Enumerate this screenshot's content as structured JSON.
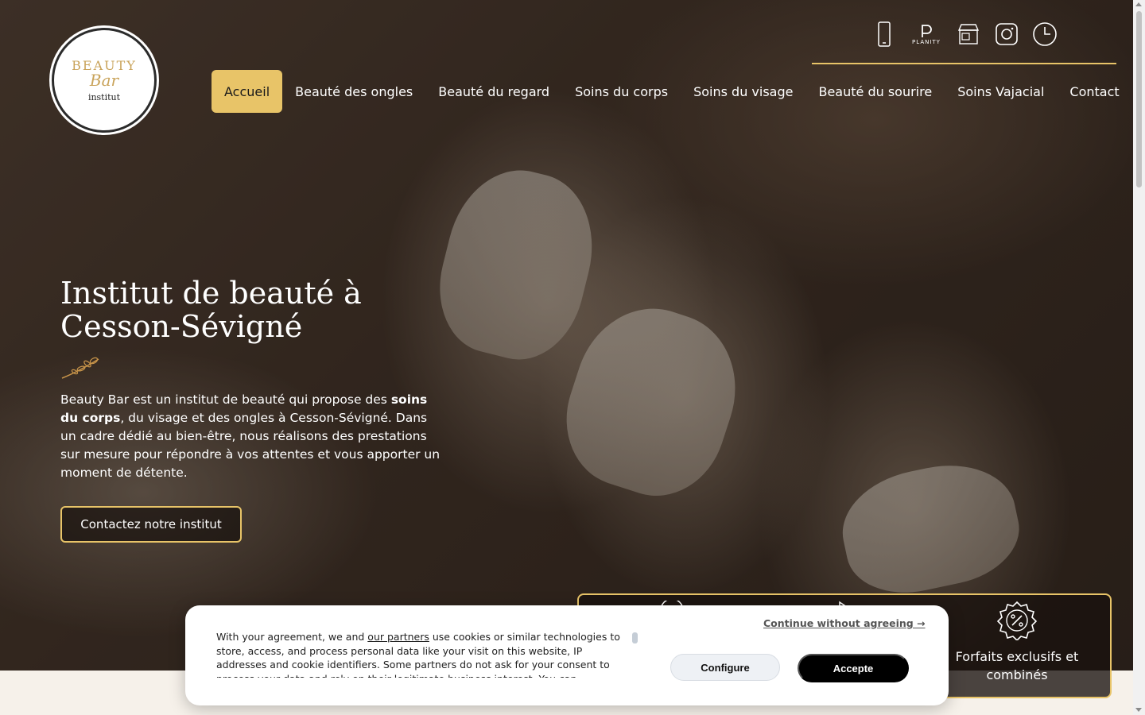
{
  "logo": {
    "line1": "BEAUTY",
    "line2": "Bar",
    "line3": "institut"
  },
  "top_icons": [
    "phone-icon",
    "planity-icon",
    "storefront-icon",
    "instagram-icon",
    "clock-icon"
  ],
  "planity_label": "PLANITY",
  "nav": {
    "items": [
      {
        "label": "Accueil",
        "active": true
      },
      {
        "label": "Beauté des ongles"
      },
      {
        "label": "Beauté du regard"
      },
      {
        "label": "Soins du corps"
      },
      {
        "label": "Soins du visage"
      },
      {
        "label": "Beauté du sourire"
      },
      {
        "label": "Soins Vajacial"
      },
      {
        "label": "Contact"
      }
    ]
  },
  "hero": {
    "title_line1": "Institut de beauté à",
    "title_line2": "Cesson-Sévigné",
    "intro_before": "Beauty Bar est un institut de beauté qui propose des ",
    "intro_bold": "soins du corps",
    "intro_after": ", du visage et des ongles à Cesson-Sévigné. Dans un cadre dédié au bien-être, nous réalisons des prestations sur mesure pour répondre à vos attentes et vous apporter un moment de détente.",
    "cta": "Contactez notre institut"
  },
  "features": {
    "visible_label": "Forfaits exclusifs et combinés",
    "icon": "percent-badge-icon"
  },
  "cookie": {
    "text_before": "With your agreement, we and ",
    "partners_link": "our partners",
    "text_after": " use cookies or similar technologies to store, access, and process personal data like your visit on this website, IP addresses and cookie identifiers. Some partners do not ask for your consent to process your data and rely on their legitimate business interest. You can",
    "continue": "Continue without agreeing →",
    "configure": "Configure",
    "accept": "Accepte"
  },
  "colors": {
    "gold": "#e8c468",
    "dark": "#2e231c"
  }
}
